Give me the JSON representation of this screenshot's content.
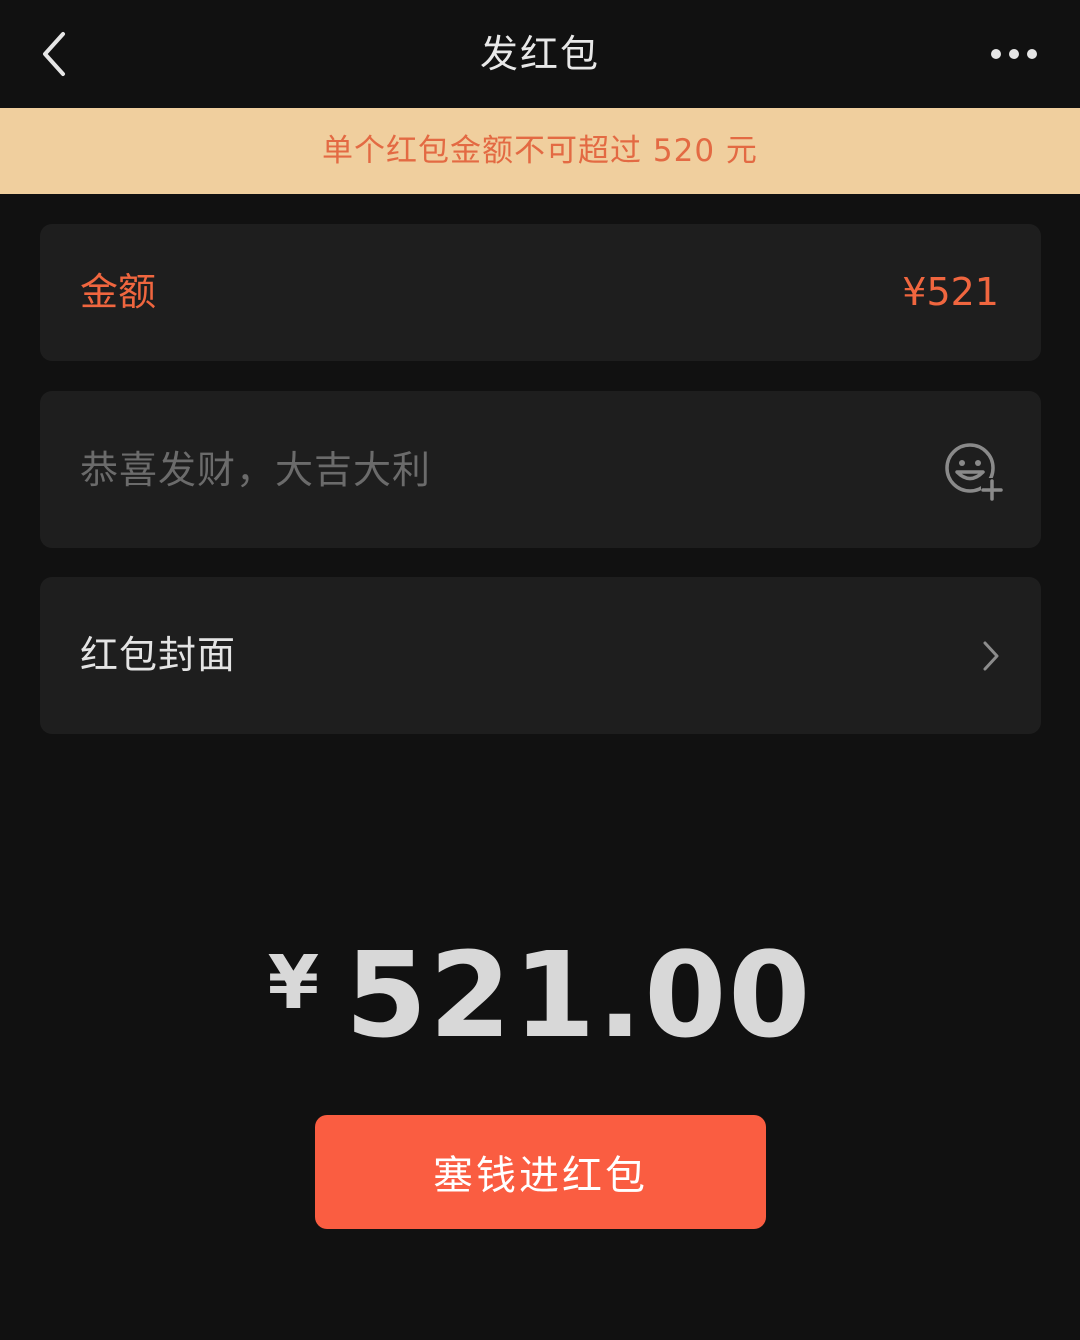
{
  "nav": {
    "title": "发红包",
    "back_icon": "chevron-left-icon",
    "more_icon": "more-dots-icon"
  },
  "notice": {
    "text": "单个红包金额不可超过 520 元"
  },
  "amount": {
    "label": "金额",
    "value": "¥521"
  },
  "greeting": {
    "value": "",
    "placeholder": "恭喜发财，大吉大利",
    "emoji_icon": "emoji-add-icon"
  },
  "cover": {
    "label": "红包封面",
    "chevron_icon": "chevron-right-icon"
  },
  "total": {
    "currency": "¥",
    "value": "521.00"
  },
  "send_button": {
    "label": "塞钱进红包"
  },
  "colors": {
    "background": "#111111",
    "card": "#1e1e1e",
    "notice_bg": "#f0cf9e",
    "accent": "#f0663f",
    "button": "#fa5d41"
  }
}
